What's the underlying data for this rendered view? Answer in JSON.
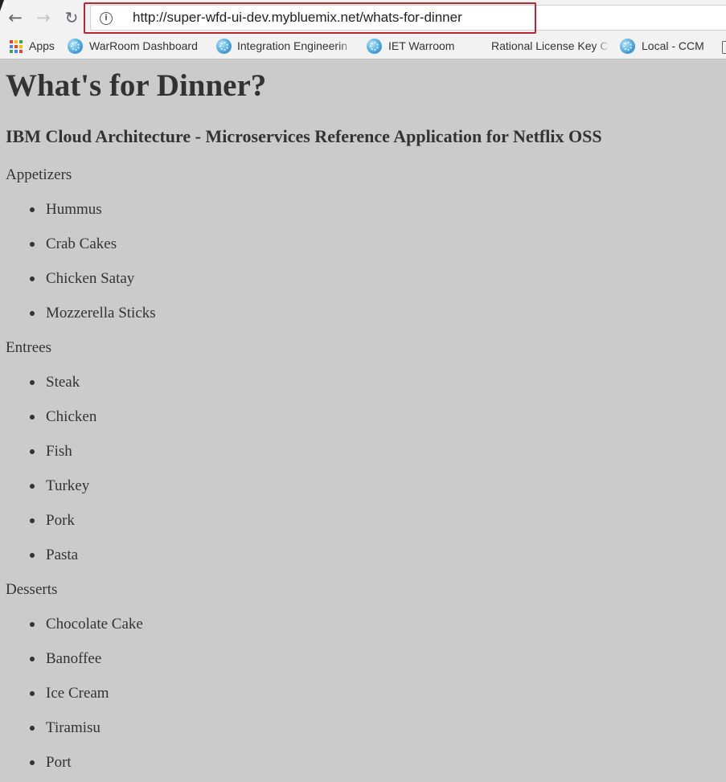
{
  "browser": {
    "url": "http://super-wfd-ui-dev.mybluemix.net/whats-for-dinner",
    "bookmarks": [
      {
        "label": "Apps",
        "icon": "apps-grid-icon"
      },
      {
        "label": "WarRoom Dashboard",
        "icon": "globe-icon"
      },
      {
        "label": "Integration Engineerin",
        "icon": "globe-icon"
      },
      {
        "label": "IET Warroom",
        "icon": "globe-icon"
      },
      {
        "label": "Rational License Key C",
        "icon": "none"
      },
      {
        "label": "Local - CCM",
        "icon": "globe-icon"
      }
    ],
    "highlight_color": "#b8262f"
  },
  "page": {
    "title": "What's for Dinner?",
    "subtitle": "IBM Cloud Architecture - Microservices Reference Application for Netflix OSS",
    "menu": [
      {
        "category": "Appetizers",
        "items": [
          "Hummus",
          "Crab Cakes",
          "Chicken Satay",
          "Mozzerella Sticks"
        ]
      },
      {
        "category": "Entrees",
        "items": [
          "Steak",
          "Chicken",
          "Fish",
          "Turkey",
          "Pork",
          "Pasta"
        ]
      },
      {
        "category": "Desserts",
        "items": [
          "Chocolate Cake",
          "Banoffee",
          "Ice Cream",
          "Tiramisu",
          "Port"
        ]
      }
    ],
    "background_color": "#cbcbcb",
    "text_color": "#333333"
  }
}
